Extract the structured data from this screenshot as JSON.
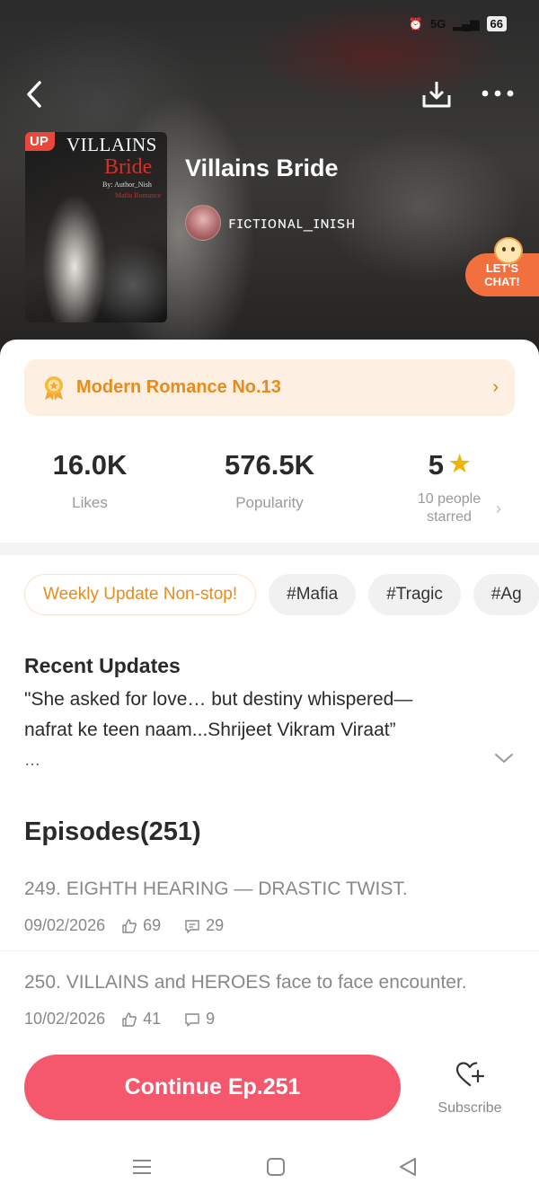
{
  "status_bar": {
    "signal": "5G",
    "battery": "66"
  },
  "header": {
    "back_icon": "back-arrow-icon",
    "download_icon": "download-icon",
    "more_icon": "more-dots-icon"
  },
  "cover": {
    "badge": "UP",
    "line1": "VILLAINS",
    "line2": "Bride",
    "line3": "By: Author_Nish",
    "line4": "Mafia Romance"
  },
  "book": {
    "title": "Villains Bride",
    "author": "ꜰɪᴄᴛɪᴏɴᴀʟ_ɪɴɪꜱʜ"
  },
  "chat_badge": {
    "line1": "LET'S",
    "line2": "CHAT!"
  },
  "ranking": {
    "label": "Modern Romance No.13"
  },
  "stats": {
    "likes": {
      "value": "16.0K",
      "label": "Likes"
    },
    "popularity": {
      "value": "576.5K",
      "label": "Popularity"
    },
    "rating": {
      "value": "5",
      "label_line1": "10 people",
      "label_line2": "starred"
    }
  },
  "tags": [
    "Weekly Update Non-stop!",
    "#Mafia",
    "#Tragic",
    "#Ag"
  ],
  "recent_updates": {
    "heading": "Recent Updates",
    "text": "\"She asked for love… but destiny whispered—nafrat ke teen naam...Shrijeet Vikram Viraat”",
    "ellipsis": "…"
  },
  "episodes": {
    "heading": "Episodes(251)",
    "items": [
      {
        "title": "249. EIGHTH HEARING — DRASTIC TWIST.",
        "date": "09/02/2026",
        "likes": "69",
        "comments": "29"
      },
      {
        "title": "250. VILLAINS and HEROES face to face encounter.",
        "date": "10/02/2026",
        "likes": "41",
        "comments": "9"
      }
    ]
  },
  "bottom_bar": {
    "continue_label": "Continue Ep.251",
    "subscribe_label": "Subscribe"
  },
  "colors": {
    "accent": "#f5576c",
    "rank_text": "#ea8a18",
    "rank_bg": "#fdf0e2",
    "star": "#f2b400"
  }
}
